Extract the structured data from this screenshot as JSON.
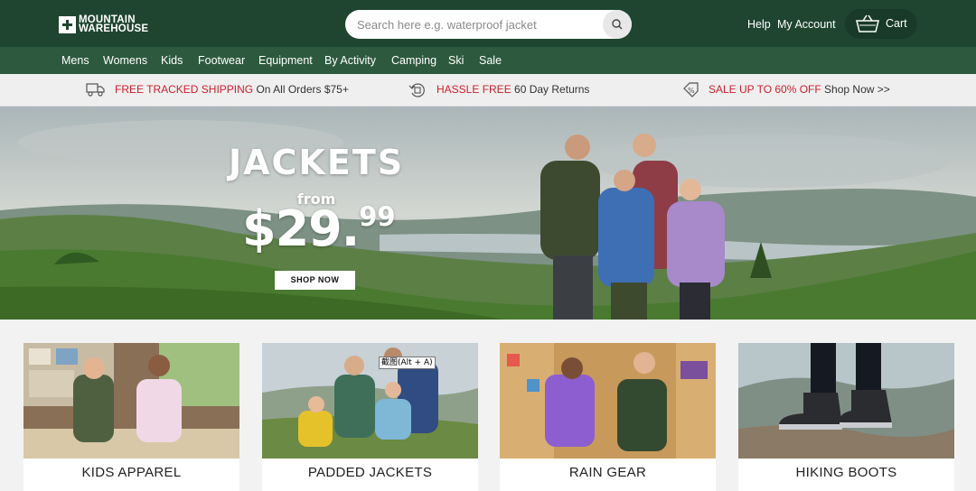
{
  "header": {
    "logo_line1": "MOUNTAIN",
    "logo_line2": "WAREHOUSE",
    "search_placeholder": "Search here e.g. waterproof jacket",
    "help": "Help",
    "my_account": "My Account",
    "cart": "Cart"
  },
  "nav": {
    "items": [
      "Mens",
      "Womens",
      "Kids",
      "Footwear",
      "Equipment",
      "By Activity",
      "Camping",
      "Ski",
      "Sale"
    ]
  },
  "benefits": [
    {
      "icon": "truck-icon",
      "highlight": "FREE TRACKED SHIPPING",
      "text": " On All Orders $75+"
    },
    {
      "icon": "returns-icon",
      "highlight": "HASSLE FREE",
      "text": " 60 Day Returns"
    },
    {
      "icon": "discount-tag-icon",
      "highlight": "SALE UP TO 60% OFF",
      "text": " Shop Now >>"
    }
  ],
  "hero": {
    "title": "JACKETS",
    "from": "from",
    "price_main": "$29.",
    "price_cents": "99",
    "cta": "SHOP NOW"
  },
  "categories": [
    {
      "label": "KIDS APPAREL"
    },
    {
      "label": "PADDED JACKETS",
      "tooltip": "截图(Alt + A)"
    },
    {
      "label": "RAIN GEAR"
    },
    {
      "label": "HIKING BOOTS"
    }
  ],
  "colors": {
    "header_green": "#1f4530",
    "nav_green": "#2d5a3e",
    "accent_red": "#d11d2b"
  }
}
